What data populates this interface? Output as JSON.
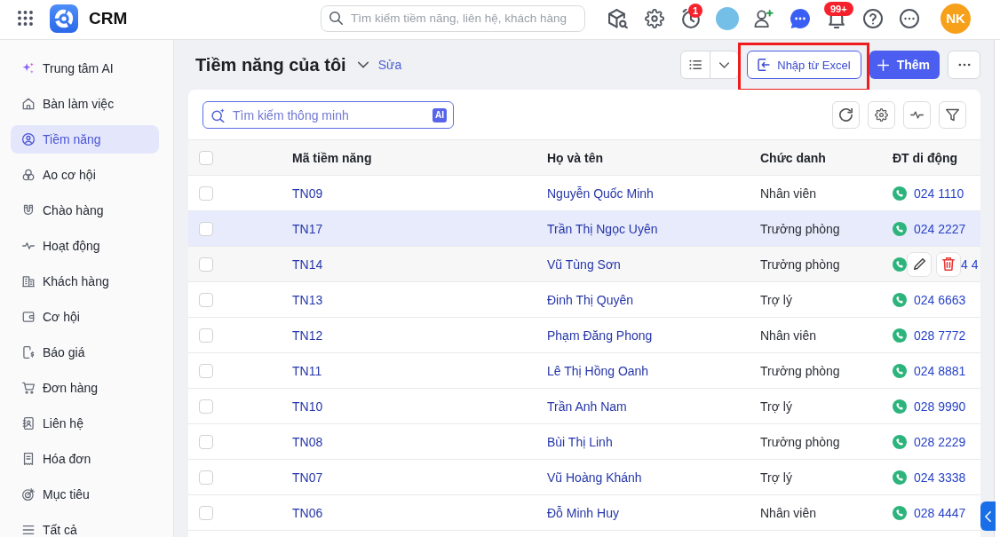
{
  "topbar": {
    "app_name": "CRM",
    "search": {
      "placeholder": "Tìm kiếm tiềm năng, liên hệ, khách hàng"
    },
    "reminder_badge": "1",
    "notification_badge": "99+",
    "user_initials": "NK"
  },
  "sidebar": {
    "items": [
      {
        "label": "Trung tâm AI",
        "selected": false
      },
      {
        "label": "Bàn làm việc",
        "selected": false
      },
      {
        "label": "Tiềm năng",
        "selected": true
      },
      {
        "label": "Ao cơ hội",
        "selected": false
      },
      {
        "label": "Chào hàng",
        "selected": false
      },
      {
        "label": "Hoạt động",
        "selected": false
      },
      {
        "label": "Khách hàng",
        "selected": false
      },
      {
        "label": "Cơ hội",
        "selected": false
      },
      {
        "label": "Báo giá",
        "selected": false
      },
      {
        "label": "Đơn hàng",
        "selected": false
      },
      {
        "label": "Liên hệ",
        "selected": false
      },
      {
        "label": "Hóa đơn",
        "selected": false
      },
      {
        "label": "Mục tiêu",
        "selected": false
      },
      {
        "label": "Tất cả",
        "selected": false
      }
    ]
  },
  "page": {
    "title": "Tiềm năng của tôi",
    "edit_link": "Sửa",
    "import_button": {
      "label": "Nhập từ Excel",
      "highlighted": true
    },
    "add_button": "Thêm"
  },
  "smart_search": {
    "placeholder": "Tìm kiếm thông minh",
    "badge": "AI"
  },
  "table": {
    "all_checked": false,
    "columns": [
      "Mã tiềm năng",
      "Họ và tên",
      "Chức danh",
      "ĐT di động"
    ],
    "rows": [
      {
        "code": "TN09",
        "name": "Nguyễn Quốc Minh",
        "title": "Nhân viên",
        "phone": "024 1110",
        "checked": false,
        "selected": false,
        "hovered": false
      },
      {
        "code": "TN17",
        "name": "Trần Thị Ngọc Uyên",
        "title": "Trưởng phòng",
        "phone": "024 2227",
        "checked": false,
        "selected": true,
        "hovered": false
      },
      {
        "code": "TN14",
        "name": "Vũ Tùng Sơn",
        "title": "Trưởng phòng",
        "phone": "4 4",
        "checked": false,
        "selected": false,
        "hovered": true
      },
      {
        "code": "TN13",
        "name": "Đinh Thị Quyên",
        "title": "Trợ lý",
        "phone": "024 6663",
        "checked": false,
        "selected": false,
        "hovered": false
      },
      {
        "code": "TN12",
        "name": "Phạm Đăng Phong",
        "title": "Nhân viên",
        "phone": "028 7772",
        "checked": false,
        "selected": false,
        "hovered": false
      },
      {
        "code": "TN11",
        "name": "Lê Thị Hồng Oanh",
        "title": "Trưởng phòng",
        "phone": "024 8881",
        "checked": false,
        "selected": false,
        "hovered": false
      },
      {
        "code": "TN10",
        "name": "Trần Anh Nam",
        "title": "Trợ lý",
        "phone": "028 9990",
        "checked": false,
        "selected": false,
        "hovered": false
      },
      {
        "code": "TN08",
        "name": "Bùi Thị Linh",
        "title": "Trưởng phòng",
        "phone": "028 2229",
        "checked": false,
        "selected": false,
        "hovered": false
      },
      {
        "code": "TN07",
        "name": "Vũ Hoàng Khánh",
        "title": "Trợ lý",
        "phone": "024 3338",
        "checked": false,
        "selected": false,
        "hovered": false
      },
      {
        "code": "TN06",
        "name": "Đỗ Minh Huy",
        "title": "Nhân viên",
        "phone": "028 4447",
        "checked": false,
        "selected": false,
        "hovered": false
      }
    ]
  }
}
